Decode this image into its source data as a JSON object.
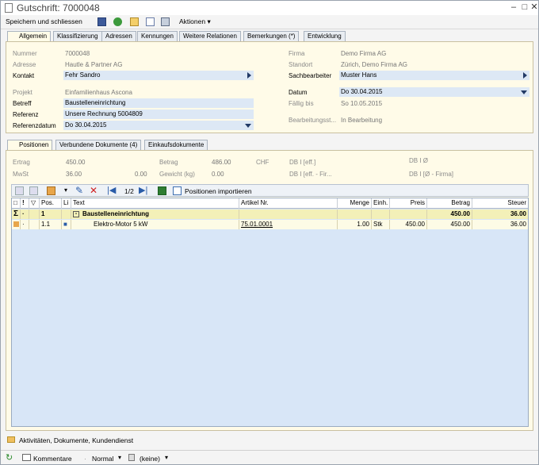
{
  "window": {
    "title": "Gutschrift: 7000048"
  },
  "toolbar": {
    "save_close": "Speichern und schliessen",
    "actions": "Aktionen"
  },
  "tabs": [
    "Allgemein",
    "Klassifizierung",
    "Adressen",
    "Kennungen",
    "Weitere Relationen",
    "Bemerkungen (*)",
    "Entwicklung"
  ],
  "form": {
    "nummer_label": "Nummer",
    "nummer": "7000048",
    "adresse_label": "Adresse",
    "adresse": "Hautle & Partner AG",
    "kontakt_label": "Kontakt",
    "kontakt": "Fehr Sandro",
    "projekt_label": "Projekt",
    "projekt": "Einfamilienhaus Ascona",
    "betreff_label": "Betreff",
    "betreff": "Baustelleneinrichtung",
    "referenz_label": "Referenz",
    "referenz": "Unsere Rechnung 5004809",
    "referenzdatum_label": "Referenzdatum",
    "referenzdatum": "Do 30.04.2015",
    "firma_label": "Firma",
    "firma": "Demo Firma AG",
    "standort_label": "Standort",
    "standort": "Zürich, Demo Firma AG",
    "sachbearbeiter_label": "Sachbearbeiter",
    "sachbearbeiter": "Muster Hans",
    "datum_label": "Datum",
    "datum": "Do 30.04.2015",
    "faellig_label": "Fällig bis",
    "faellig": "So 10.05.2015",
    "status_label": "Bearbeitungsst...",
    "status": "In Bearbeitung"
  },
  "subtabs": [
    "Positionen",
    "Verbundene Dokumente (4)",
    "Einkaufsdokumente"
  ],
  "summary": {
    "ertrag_label": "Ertrag",
    "ertrag": "450.00",
    "mwst_label": "MwSt",
    "mwst": "36.00",
    "mwst2": "0.00",
    "betrag_label": "Betrag",
    "betrag": "486.00",
    "currency": "CHF",
    "gewicht_label": "Gewicht (kg)",
    "gewicht": "0.00",
    "db1_label": "DB I [eff.]",
    "db2_label": "DB I [eff. - Fir...",
    "db3_label": "DB I Ø",
    "db4_label": "DB I [Ø - Firma]"
  },
  "grid_toolbar": {
    "page": "1/2",
    "import": "Positionen importieren"
  },
  "grid": {
    "headers": [
      "Pos.",
      "Li",
      "Text",
      "Artikel Nr.",
      "Menge",
      "Einh.",
      "Preis",
      "Betrag",
      "Steuer"
    ],
    "group": {
      "pos": "1",
      "text": "Baustelleneinrichtung",
      "betrag": "450.00",
      "steuer": "36.00"
    },
    "row": {
      "pos": "1.1",
      "text": "Elektro-Motor 5 kW",
      "artikel": "75.01.0001",
      "menge": "1.00",
      "einh": "Stk",
      "preis": "450.00",
      "betrag": "450.00",
      "steuer": "36.00"
    }
  },
  "footer": {
    "section": "Aktivitäten, Dokumente, Kundendienst",
    "comments": "Kommentare",
    "priority": "Normal",
    "flag": "(keine)"
  }
}
